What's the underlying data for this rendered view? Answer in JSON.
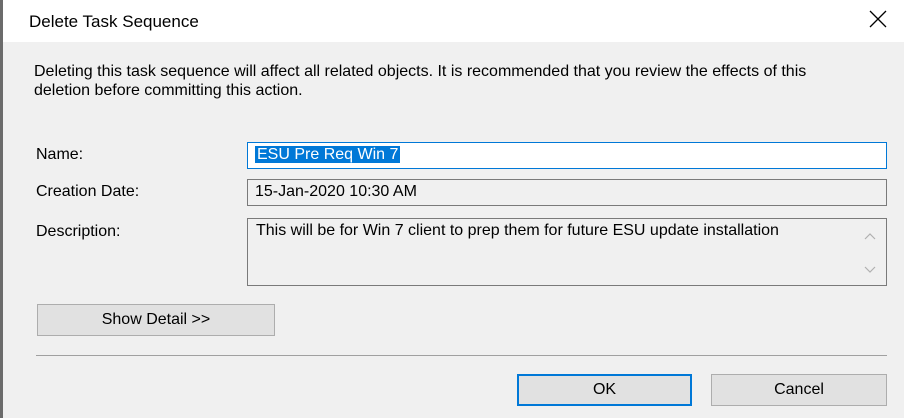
{
  "dialog": {
    "title": "Delete Task Sequence",
    "message": "Deleting this task sequence will affect all related objects. It is recommended that you review the effects of this deletion before committing this action."
  },
  "fields": {
    "name_label": "Name:",
    "name_value": "ESU Pre Req Win 7",
    "date_label": "Creation Date:",
    "date_value": "15-Jan-2020 10:30 AM",
    "description_label": "Description:",
    "description_value": "This will be for Win 7 client to prep them for future ESU update installation"
  },
  "buttons": {
    "show_detail": "Show Detail >>",
    "ok": "OK",
    "cancel": "Cancel"
  },
  "icons": {
    "close": "close-icon",
    "scroll_up": "chevron-up-icon",
    "scroll_down": "chevron-down-icon"
  },
  "colors": {
    "accent": "#0078d7",
    "window_bg": "#f0f0f0",
    "button_bg": "#e1e1e1"
  }
}
